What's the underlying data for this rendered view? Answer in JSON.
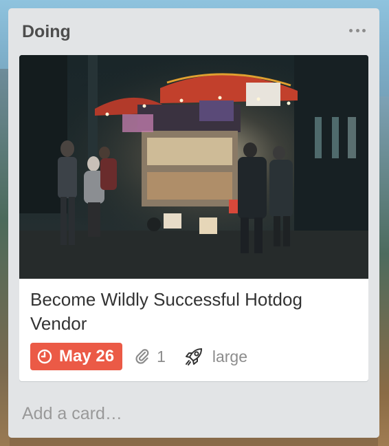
{
  "list": {
    "title": "Doing",
    "menu_icon": "more-horizontal-icon",
    "add_card_label": "Add a card…"
  },
  "card": {
    "cover_image": "hotdog-cart-night-photo",
    "title": "Become Wildly Successful Hotdog Vendor",
    "badges": {
      "due_date": "May 26",
      "due_icon": "clock-icon",
      "due_color": "#eb5a46",
      "attachments_count": "1",
      "attachment_icon": "paperclip-icon",
      "size_icon": "rocket-icon",
      "size_label": "large"
    }
  },
  "colors": {
    "list_background": "#e2e4e6",
    "card_background": "#ffffff",
    "text": "#333333",
    "muted": "#8c8c8c"
  }
}
